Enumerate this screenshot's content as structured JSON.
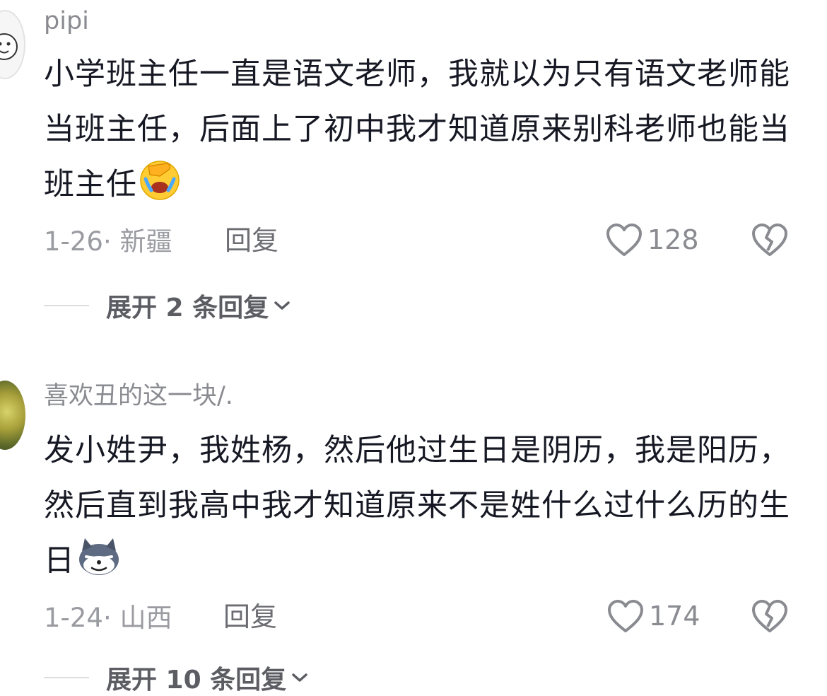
{
  "comments": [
    {
      "username": "pipi",
      "text": "小学班主任一直是语文老师，我就以为只有语文老师能当班主任，后面上了初中我才知道原来别科老师也能当班主任",
      "emoji": "facepalm-laugh-emoji",
      "date_location": "1-26· 新疆",
      "reply_label": "回复",
      "like_count": "128",
      "expand_label": "展开 2 条回复"
    },
    {
      "username": "喜欢丑的这一块/.",
      "text": "发小姓尹，我姓杨，然后他过生日是阴历，我是阳历，然后直到我高中我才知道原来不是姓什么过什么历的生日",
      "emoji": "smug-wolf-emoji",
      "date_location": "1-24· 山西",
      "reply_label": "回复",
      "like_count": "174",
      "expand_label": "展开 10 条回复"
    }
  ],
  "icons": {
    "like": "heart-outline-icon",
    "dislike": "broken-heart-icon",
    "expand": "chevron-down-icon"
  },
  "colors": {
    "text_primary": "#161823",
    "text_secondary": "#8a8b91"
  }
}
